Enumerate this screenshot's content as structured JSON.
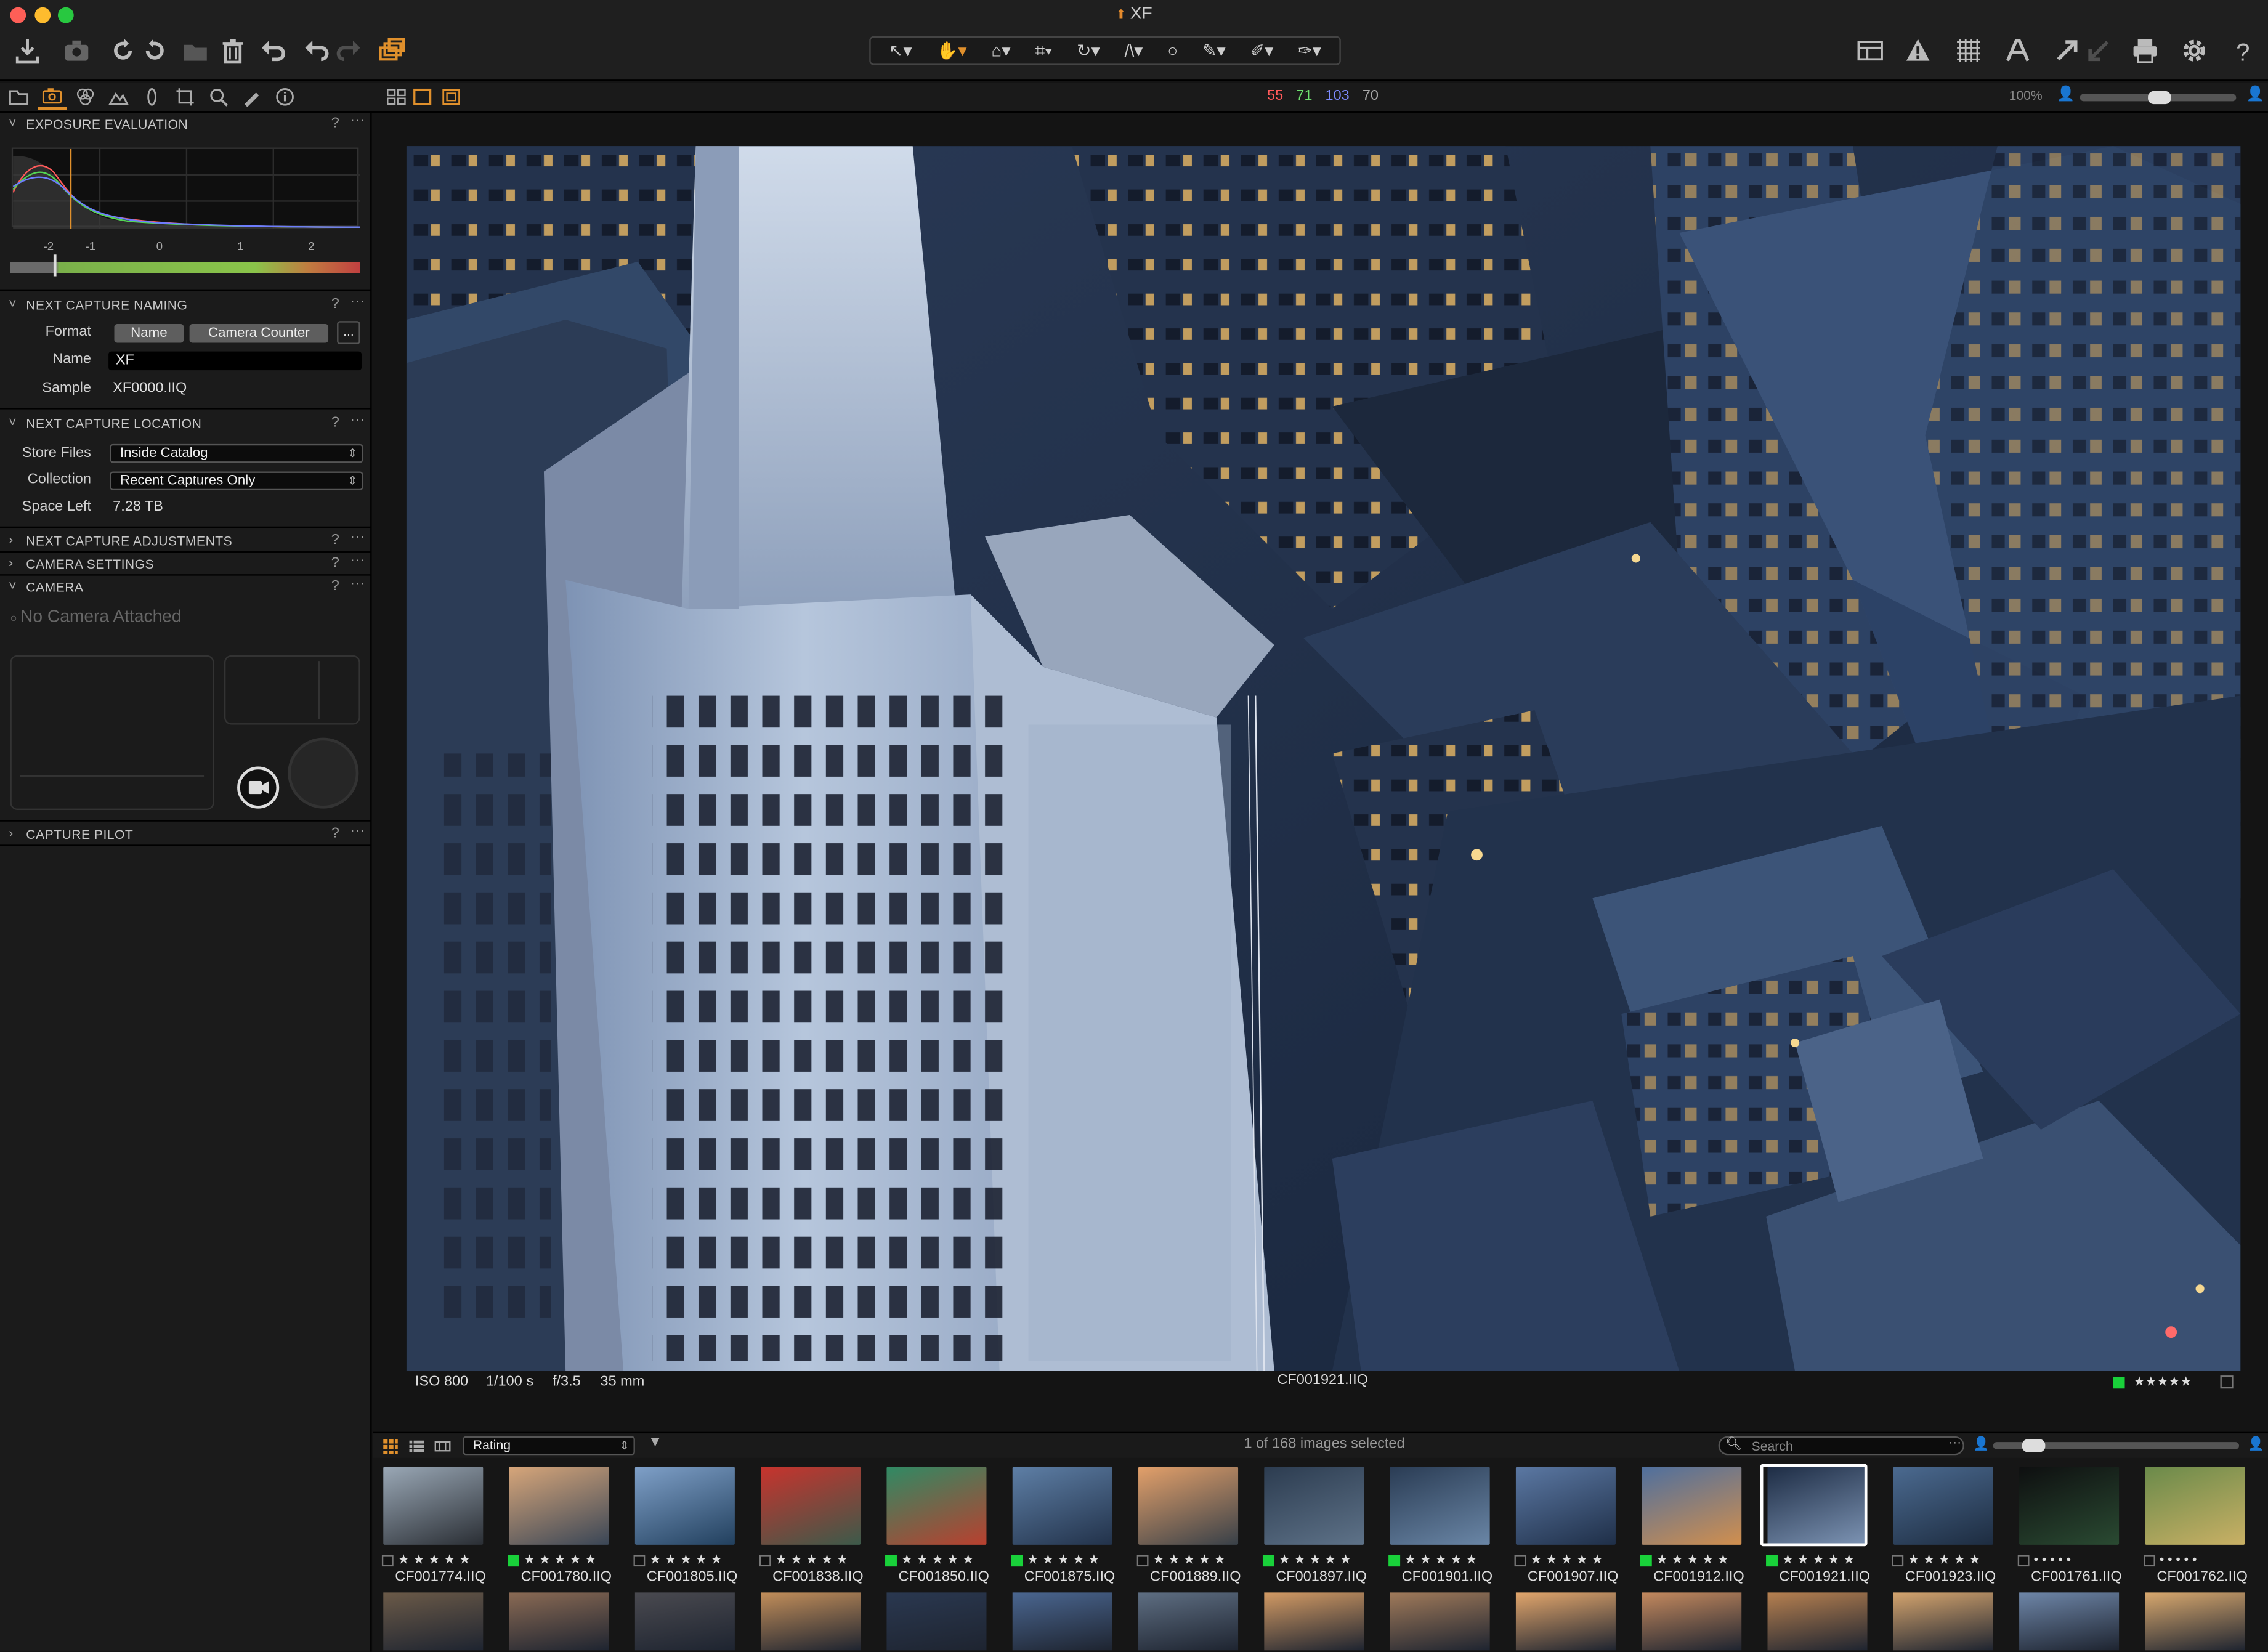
{
  "window": {
    "title": "XF",
    "traffic": [
      "#fe5f57",
      "#febc2e",
      "#28c840"
    ]
  },
  "toolbar": {
    "left_icons": [
      "import-icon",
      "camera-icon",
      "rotate-left-icon",
      "rotate-right-icon",
      "folder-icon",
      "trash-icon",
      "undo-icon",
      "undo-more-icon",
      "redo-icon",
      "variants-icon"
    ],
    "cursor_tools": [
      "↖",
      "✋",
      "⬚",
      "⌗",
      "↻",
      "⟋",
      "○",
      "✎",
      "✐",
      "✑"
    ],
    "right_icons": [
      "layout-icon",
      "warning-icon",
      "grid-icon",
      "text-icon",
      "process-icon",
      "process-alt-icon",
      "print-icon",
      "settings-icon",
      "help-icon"
    ]
  },
  "readout": {
    "r": "55",
    "g": "71",
    "b": "103",
    "l": "70",
    "zoom": "100%"
  },
  "panels": {
    "exposure": {
      "title": "EXPOSURE EVALUATION",
      "ticks": [
        "-2",
        "-1",
        "0",
        "1",
        "2"
      ]
    },
    "naming": {
      "title": "NEXT CAPTURE NAMING",
      "format_label": "Format",
      "format_tokens": [
        "Name",
        "Camera Counter"
      ],
      "more": "...",
      "name_label": "Name",
      "name_value": "XF",
      "sample_label": "Sample",
      "sample_value": "XF0000.IIQ"
    },
    "location": {
      "title": "NEXT CAPTURE LOCATION",
      "store_label": "Store Files",
      "store_value": "Inside Catalog",
      "collection_label": "Collection",
      "collection_value": "Recent Captures Only",
      "space_label": "Space Left",
      "space_value": "7.28 TB"
    },
    "adjustments": {
      "title": "NEXT CAPTURE ADJUSTMENTS"
    },
    "camera_settings": {
      "title": "CAMERA SETTINGS"
    },
    "camera": {
      "title": "CAMERA",
      "status": "No Camera Attached"
    },
    "pilot": {
      "title": "CAPTURE PILOT"
    },
    "help": "?",
    "more": "···"
  },
  "viewer": {
    "iso": "ISO 800",
    "shutter": "1/100 s",
    "aperture": "f/3.5",
    "focal": "35 mm",
    "filename": "CF001921.IIQ",
    "rating": "★★★★★"
  },
  "browser": {
    "sort_value": "Rating",
    "status": "1 of 168 images selected",
    "search_placeholder": "Search"
  },
  "thumbs": [
    {
      "name": "CF001774.IIQ",
      "tag": "none",
      "c1": "#9aa8b6",
      "c2": "#2a2e34"
    },
    {
      "name": "CF001780.IIQ",
      "tag": "green",
      "c1": "#d7a67a",
      "c2": "#3a4656"
    },
    {
      "name": "CF001805.IIQ",
      "tag": "none",
      "c1": "#7fa0c8",
      "c2": "#22405e"
    },
    {
      "name": "CF001838.IIQ",
      "tag": "none",
      "c1": "#c8332d",
      "c2": "#3c5a4a"
    },
    {
      "name": "CF001850.IIQ",
      "tag": "green",
      "c1": "#2f8a64",
      "c2": "#b9402f"
    },
    {
      "name": "CF001875.IIQ",
      "tag": "green",
      "c1": "#5e7fa6",
      "c2": "#22324a"
    },
    {
      "name": "CF001889.IIQ",
      "tag": "none",
      "c1": "#e3a06a",
      "c2": "#384048"
    },
    {
      "name": "CF001897.IIQ",
      "tag": "green",
      "c1": "#2c3c50",
      "c2": "#5e7288"
    },
    {
      "name": "CF001901.IIQ",
      "tag": "green",
      "c1": "#2a3c54",
      "c2": "#6a86a6"
    },
    {
      "name": "CF001907.IIQ",
      "tag": "none",
      "c1": "#5b78a3",
      "c2": "#1f2f48"
    },
    {
      "name": "CF001912.IIQ",
      "tag": "green",
      "c1": "#4e6f9e",
      "c2": "#d18f4e"
    },
    {
      "name": "CF001921.IIQ",
      "tag": "green",
      "c1": "#1d2c44",
      "c2": "#7d94b4",
      "selected": true
    },
    {
      "name": "CF001923.IIQ",
      "tag": "none",
      "c1": "#4b6a90",
      "c2": "#1d2c40"
    },
    {
      "name": "CF001761.IIQ",
      "tag": "none",
      "c1": "#0e0f10",
      "c2": "#2a4a32",
      "dots": true
    },
    {
      "name": "CF001762.IIQ",
      "tag": "none",
      "c1": "#6a8a4a",
      "c2": "#c9b065",
      "dots": true
    }
  ],
  "thumbs_row2": [
    "#6b5a48",
    "#8a6a54",
    "#4a4a50",
    "#c28e5a",
    "#2a3850",
    "#4a6690",
    "#5e6e82",
    "#d29a64",
    "#a07a5a",
    "#e2a66c",
    "#c4895e",
    "#b68050",
    "#d4a46e",
    "#6e86a8",
    "#d8a86e"
  ]
}
